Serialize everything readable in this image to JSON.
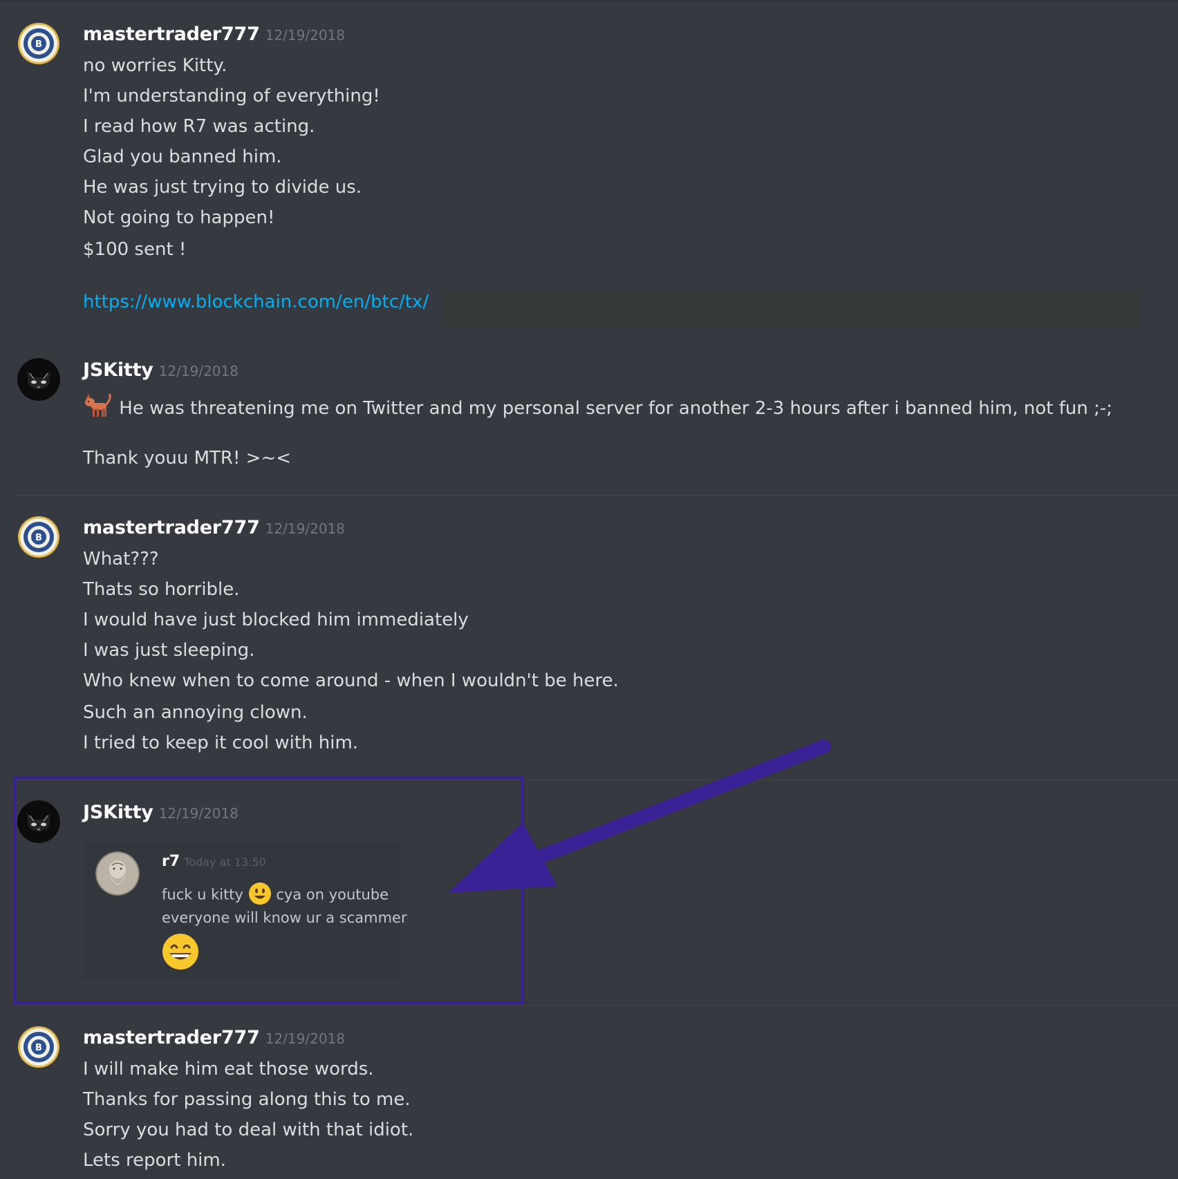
{
  "messages": [
    {
      "username": "mastertrader777",
      "timestamp": "12/19/2018",
      "lines": [
        "no worries Kitty.",
        "I'm understanding of everything!",
        "I read how R7 was acting.",
        "Glad you banned him.",
        "He was just trying to divide us.",
        "Not going to happen!",
        "$100 sent !"
      ],
      "link": "https://www.blockchain.com/en/btc/tx/"
    },
    {
      "username": "JSKitty",
      "timestamp": "12/19/2018",
      "lines": [
        "He was threatening me on Twitter and my personal server for another 2-3 hours after i banned him, not fun ;-;",
        "Thank youu MTR! >~<"
      ]
    },
    {
      "username": "mastertrader777",
      "timestamp": "12/19/2018",
      "lines": [
        "What???",
        "Thats so horrible.",
        "I would have just blocked him immediately",
        "I was just sleeping.",
        "Who knew when to come around - when I wouldn't be here.",
        "Such an annoying clown.",
        "I tried to keep it cool with him."
      ]
    },
    {
      "username": "JSKitty",
      "timestamp": "12/19/2018",
      "embed": {
        "username": "r7",
        "timestamp": "Today at 13:50",
        "line1_a": "fuck u kitty",
        "line1_b": "cya on youtube",
        "line2": "everyone will know ur a scammer"
      }
    },
    {
      "username": "mastertrader777",
      "timestamp": "12/19/2018",
      "lines": [
        "I will make him eat those words.",
        "Thanks for passing along this to me.",
        "Sorry you had to deal with that idiot.",
        "Lets report him."
      ]
    }
  ],
  "icons": {
    "mastertrader_avatar": "bitcoin-seal-avatar-icon",
    "jskitty_avatar": "black-cat-avatar-icon",
    "r7_avatar": "bearded-man-avatar-icon",
    "cat_emoji": "cat-emoji-icon",
    "smiley_emoji": "smiley-emoji-icon",
    "grin_emoji": "grin-emoji-icon",
    "annotation_arrow": "arrow-annotation-icon"
  },
  "colors": {
    "background": "#36393f",
    "username": "#ffffff",
    "timestamp": "#72767d",
    "text": "#dcddde",
    "link": "#00b0f4",
    "annotation": "#3a2196"
  }
}
